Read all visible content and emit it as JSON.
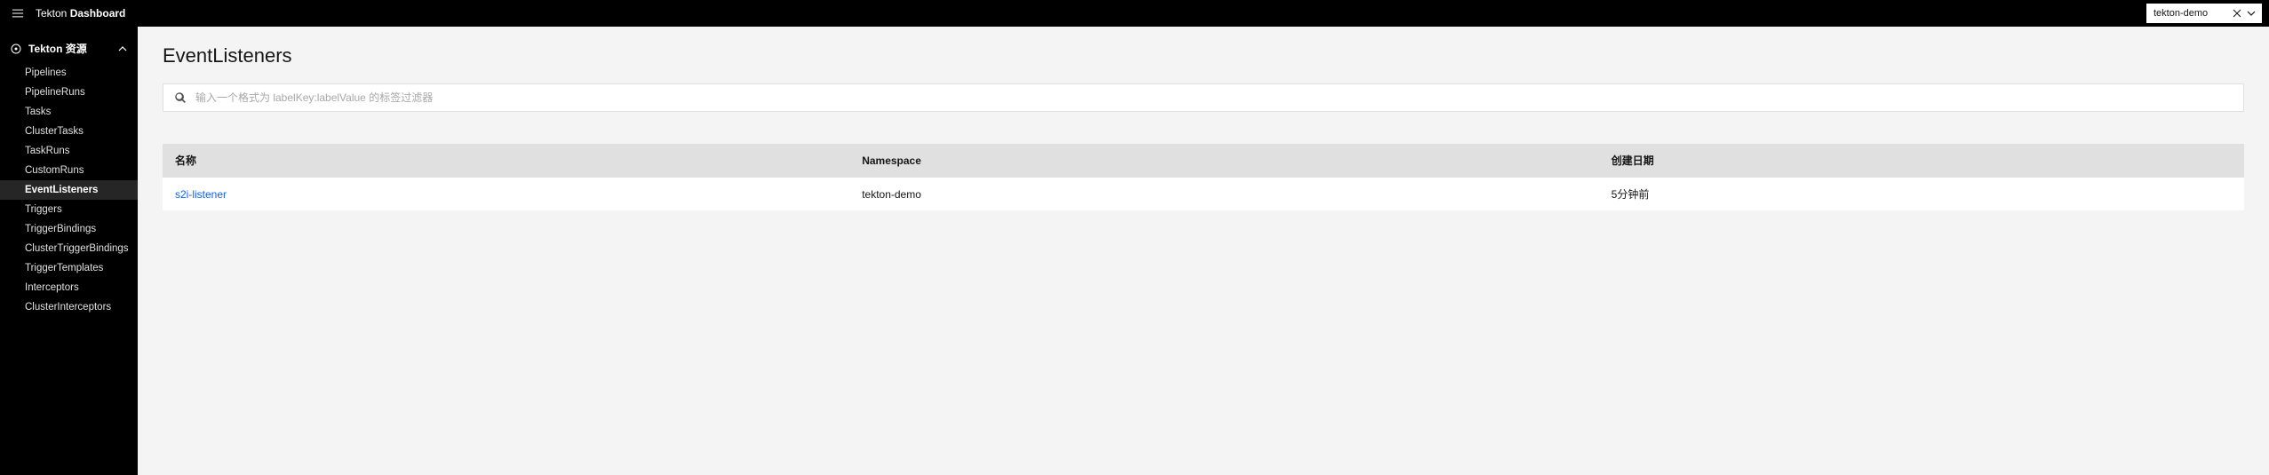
{
  "header": {
    "brand_prefix": "Tekton ",
    "brand_name": "Dashboard",
    "namespace": "tekton-demo"
  },
  "sidebar": {
    "section_label": "Tekton 资源",
    "items": [
      {
        "label": "Pipelines"
      },
      {
        "label": "PipelineRuns"
      },
      {
        "label": "Tasks"
      },
      {
        "label": "ClusterTasks"
      },
      {
        "label": "TaskRuns"
      },
      {
        "label": "CustomRuns"
      },
      {
        "label": "EventListeners"
      },
      {
        "label": "Triggers"
      },
      {
        "label": "TriggerBindings"
      },
      {
        "label": "ClusterTriggerBindings"
      },
      {
        "label": "TriggerTemplates"
      },
      {
        "label": "Interceptors"
      },
      {
        "label": "ClusterInterceptors"
      }
    ],
    "active_index": 6
  },
  "main": {
    "title": "EventListeners",
    "search_placeholder": "输入一个格式为 labelKey:labelValue 的标签过滤器",
    "table": {
      "headers": {
        "name": "名称",
        "namespace": "Namespace",
        "created": "创建日期"
      },
      "rows": [
        {
          "name": "s2i-listener",
          "namespace": "tekton-demo",
          "created": "5分钟前"
        }
      ]
    }
  }
}
